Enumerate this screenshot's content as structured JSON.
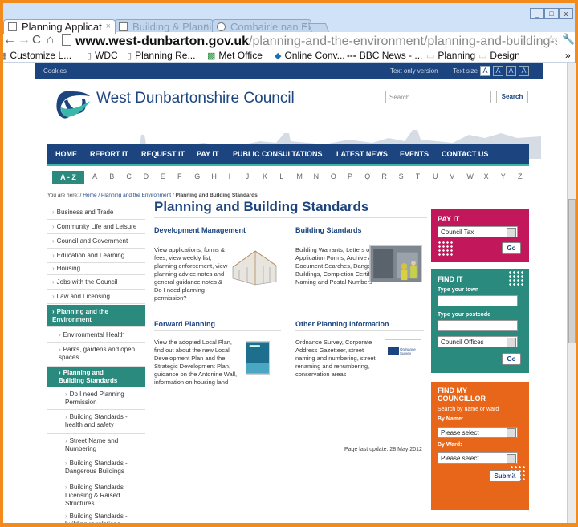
{
  "browser": {
    "tabs": [
      {
        "label": "Planning Applicat"
      },
      {
        "label": "Building & Planni"
      },
      {
        "label": "Comhairle nan Ei"
      }
    ],
    "url_host": "www.west-dunbarton.gov.uk",
    "url_path": "/planning-and-the-environment/planning-and-building-standa",
    "bookmarks": [
      {
        "label": "Customize L..."
      },
      {
        "label": "WDC"
      },
      {
        "label": "Planning Re..."
      },
      {
        "label": "Met Office"
      },
      {
        "label": "Online Conv..."
      },
      {
        "label": "BBC News - ..."
      },
      {
        "label": "Planning"
      },
      {
        "label": "Design"
      }
    ]
  },
  "topbar": {
    "cookies": "Cookies",
    "text_only": "Text only version",
    "text_size": "Text size",
    "sizes": [
      "A",
      "A",
      "A",
      "A"
    ]
  },
  "header": {
    "council_name": "West Dunbartonshire Council",
    "search_placeholder": "Search",
    "search_button": "Search"
  },
  "main_nav": [
    "HOME",
    "REPORT IT",
    "REQUEST IT",
    "PAY IT",
    "PUBLIC CONSULTATIONS",
    "LATEST NEWS",
    "EVENTS",
    "CONTACT US"
  ],
  "az": {
    "label": "A - Z",
    "letters": [
      "A",
      "B",
      "C",
      "D",
      "E",
      "F",
      "G",
      "H",
      "I",
      "J",
      "K",
      "L",
      "M",
      "N",
      "O",
      "P",
      "Q",
      "R",
      "S",
      "T",
      "U",
      "V",
      "W",
      "X",
      "Y",
      "Z"
    ]
  },
  "breadcrumb": {
    "prefix": "You are here:",
    "home": "/ Home",
    "section": "/ Planning and the Environment",
    "current": "/ Planning and Building Standards"
  },
  "left_nav": [
    {
      "label": "Business and Trade"
    },
    {
      "label": "Community Life and Leisure"
    },
    {
      "label": "Council and Government"
    },
    {
      "label": "Education and Learning"
    },
    {
      "label": "Housing"
    },
    {
      "label": "Jobs with the Council"
    },
    {
      "label": "Law and Licensing"
    },
    {
      "label": "Planning and the Environment"
    },
    {
      "label": "Environmental Health"
    },
    {
      "label": "Parks, gardens and open spaces"
    },
    {
      "label": "Planning and Building Standards"
    },
    {
      "label": "Do I need Planning Permission"
    },
    {
      "label": "Building Standards - health and safety"
    },
    {
      "label": "Street Name and Numbering"
    },
    {
      "label": "Building Standards - Dangerous Buildings"
    },
    {
      "label": "Building Standards Licensing & Raised Structures"
    },
    {
      "label": "Building Standards - building regulations"
    }
  ],
  "main": {
    "title": "Planning and Building Standards",
    "sections": [
      {
        "heading": "Development Management",
        "text": "View applications, forms & fees, view weekly list, planning enforcement, view planning advice notes and general guidance notes & Do I need planning permission?"
      },
      {
        "heading": "Building Standards",
        "text": "Building Warrants, Letters of Comfort, Application Forms, Archive and Copy Document Searches, Dangerous Buildings, Completion Certificates, Street Naming and Postal Numbers"
      },
      {
        "heading": "Forward Planning",
        "text": "View the adopted Local Plan, find out about the new Local Development Plan and the Strategic Development Plan, guidance on the Antonine Wall, information on housing land"
      },
      {
        "heading": "Other Planning Information",
        "text": "Ordnance Survey, Corporate Address Gazetteer, street naming and numbering, street renaming and renumbering, conservation areas"
      }
    ],
    "os_logo_text": "Ordnance Survey",
    "last_update": "Page last update: 28 May 2012"
  },
  "widgets": {
    "pay_it": {
      "title": "PAY IT",
      "selected": "Council Tax",
      "button": "Go",
      "color": "#c2185b"
    },
    "find_it": {
      "title": "FIND IT",
      "town_label": "Type your town",
      "postcode_label": "Type your postcode",
      "selected": "Council Offices",
      "button": "Go",
      "color": "#2a8a7d"
    },
    "councillor": {
      "title": "FIND MY COUNCILLOR",
      "subtitle": "Search by name or ward",
      "by_name": "By Name:",
      "name_select": "Please select",
      "by_ward": "By Ward:",
      "ward_select": "Please select",
      "button": "Submit",
      "color": "#e8661a"
    }
  }
}
